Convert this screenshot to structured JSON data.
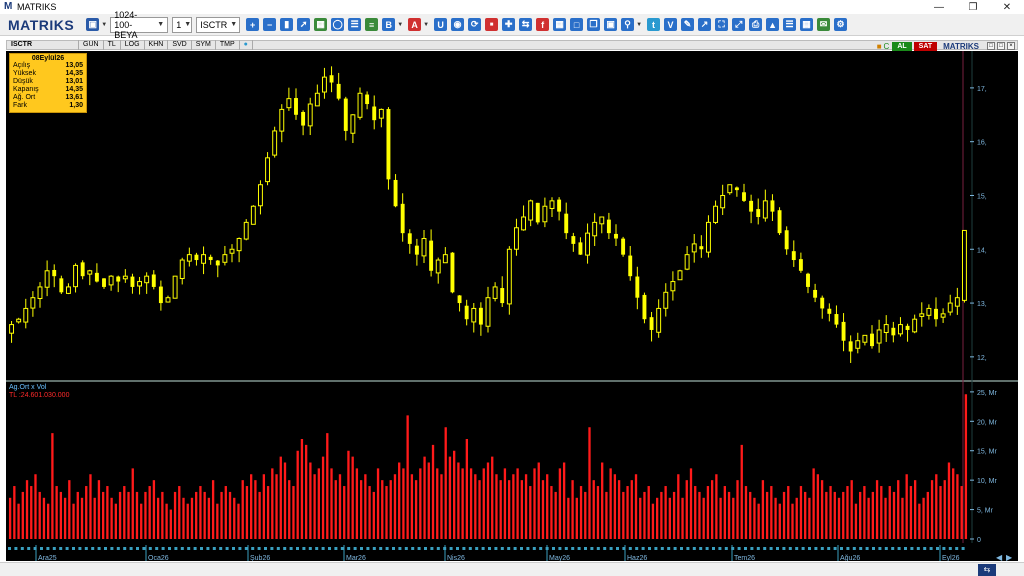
{
  "window": {
    "title": "MATRIKS",
    "logo_glyph": "M"
  },
  "toolbar": {
    "brand": "MATRIKS",
    "layout_select": "1024-100-BEYA",
    "period_select": "1",
    "symbol_select": "ISCTR"
  },
  "chart_header": {
    "symbol": "ISCTR",
    "tabs": [
      "GUN",
      "TL",
      "LOG",
      "KHN",
      "SVD",
      "SYM",
      "TMP"
    ],
    "buy_label": "AL",
    "sell_label": "SAT",
    "brand": "MATRIKS"
  },
  "infobox": {
    "date": "08Eylül26",
    "rows": [
      {
        "label": "Açılış",
        "value": "13,05"
      },
      {
        "label": "Yüksek",
        "value": "14,35"
      },
      {
        "label": "Düşük",
        "value": "13,01"
      },
      {
        "label": "Kapanış",
        "value": "14,35"
      },
      {
        "label": "Ağ. Ort",
        "value": "13,61"
      },
      {
        "label": "Fark",
        "value": "1,30"
      }
    ]
  },
  "volume_panel": {
    "title": "Ag.Ort x Vol",
    "legend": "TL      :24.601.030.000"
  },
  "colors": {
    "candle": "#ffff00",
    "volume": "#ff1a1a",
    "axis_text": "#7fb8e0",
    "divider": "#c0e0d8"
  },
  "chart_data": [
    {
      "type": "candlestick",
      "x_tick_labels": [
        "Ara25",
        "Oca26",
        "Şub26",
        "Mar26",
        "Nis26",
        "May26",
        "Haz26",
        "Tem26",
        "Ağu26",
        "Eyl26"
      ],
      "y_tick_labels": [
        "12,",
        "13,",
        "14,",
        "15,",
        "16,",
        "17,"
      ],
      "y_ticks": [
        12,
        13,
        14,
        15,
        16,
        17
      ],
      "ylim": [
        11.7,
        17.5
      ],
      "close_path": [
        12.6,
        12.7,
        12.9,
        13.1,
        13.3,
        13.6,
        13.5,
        13.2,
        13.3,
        13.7,
        13.5,
        13.6,
        13.4,
        13.3,
        13.5,
        13.4,
        13.5,
        13.3,
        13.4,
        13.5,
        13.3,
        13.0,
        13.1,
        13.5,
        13.8,
        13.9,
        13.8,
        13.9,
        13.8,
        13.7,
        13.9,
        14.0,
        14.2,
        14.5,
        14.8,
        15.2,
        15.7,
        16.2,
        16.6,
        16.8,
        16.5,
        16.3,
        16.7,
        16.9,
        17.2,
        17.1,
        16.8,
        16.2,
        16.5,
        16.9,
        16.7,
        16.4,
        16.6,
        15.3,
        14.8,
        14.3,
        14.1,
        13.9,
        14.2,
        13.6,
        13.8,
        13.9,
        13.2,
        13.0,
        12.7,
        12.9,
        12.6,
        13.1,
        13.3,
        13.0,
        14.0,
        14.4,
        14.6,
        14.9,
        14.5,
        14.8,
        14.9,
        14.7,
        14.3,
        14.1,
        13.9,
        14.3,
        14.5,
        14.6,
        14.3,
        14.2,
        13.9,
        13.5,
        13.1,
        12.7,
        12.5,
        12.9,
        13.2,
        13.4,
        13.6,
        13.9,
        14.1,
        14.0,
        14.5,
        14.8,
        15.0,
        15.2,
        15.1,
        14.9,
        14.7,
        14.6,
        14.9,
        14.7,
        14.3,
        14.0,
        13.8,
        13.6,
        13.3,
        13.1,
        12.9,
        12.8,
        12.6,
        12.3,
        12.1,
        12.3,
        12.4,
        12.2,
        12.5,
        12.6,
        12.4,
        12.6,
        12.5,
        12.7,
        12.8,
        12.9,
        12.7,
        12.8,
        13.0,
        13.1,
        14.35
      ],
      "last": {
        "open": 13.05,
        "high": 14.35,
        "low": 13.01,
        "close": 14.35
      }
    },
    {
      "type": "bar",
      "title": "Ag.Ort x Vol",
      "y_tick_labels": [
        "25, Mr",
        "20, Mr",
        "15, Mr",
        "10, Mr",
        "5, Mr",
        "0"
      ],
      "y_ticks": [
        25,
        20,
        15,
        10,
        5,
        0
      ],
      "ylim": [
        0,
        26
      ],
      "units": "Mr",
      "values": [
        7,
        9,
        6,
        8,
        10,
        9,
        11,
        8,
        7,
        6,
        18,
        9,
        8,
        7,
        10,
        6,
        8,
        7,
        9,
        11,
        7,
        10,
        8,
        9,
        7,
        6,
        8,
        9,
        8,
        12,
        8,
        6,
        8,
        9,
        10,
        7,
        8,
        6,
        5,
        8,
        9,
        7,
        6,
        7,
        8,
        9,
        8,
        7,
        10,
        6,
        8,
        9,
        8,
        7,
        6,
        10,
        9,
        11,
        10,
        8,
        11,
        9,
        12,
        11,
        14,
        13,
        10,
        9,
        15,
        17,
        16,
        13,
        11,
        12,
        14,
        18,
        12,
        10,
        11,
        9,
        15,
        14,
        12,
        10,
        11,
        9,
        8,
        12,
        10,
        9,
        10,
        11,
        13,
        12,
        21,
        11,
        10,
        12,
        14,
        13,
        16,
        12,
        11,
        19,
        14,
        15,
        13,
        12,
        17,
        12,
        11,
        10,
        12,
        13,
        14,
        11,
        10,
        12,
        10,
        11,
        12,
        10,
        11,
        9,
        12,
        13,
        10,
        11,
        9,
        8,
        12,
        13,
        7,
        10,
        7,
        9,
        8,
        19,
        10,
        9,
        13,
        8,
        12,
        11,
        10,
        8,
        9,
        10,
        11,
        7,
        8,
        9,
        6,
        7,
        8,
        9,
        7,
        8,
        11,
        7,
        10,
        12,
        9,
        8,
        7,
        9,
        10,
        11,
        7,
        9,
        8,
        7,
        10,
        16,
        9,
        8,
        7,
        6,
        10,
        8,
        9,
        7,
        6,
        8,
        9,
        6,
        7,
        9,
        8,
        7,
        12,
        11,
        10,
        8,
        9,
        8,
        7,
        8,
        9,
        10,
        6,
        8,
        9,
        7,
        8,
        10,
        9,
        7,
        9,
        8,
        10,
        7,
        11,
        9,
        10,
        6,
        7,
        8,
        10,
        11,
        9,
        10,
        13,
        12,
        11,
        9,
        24.6
      ]
    }
  ]
}
